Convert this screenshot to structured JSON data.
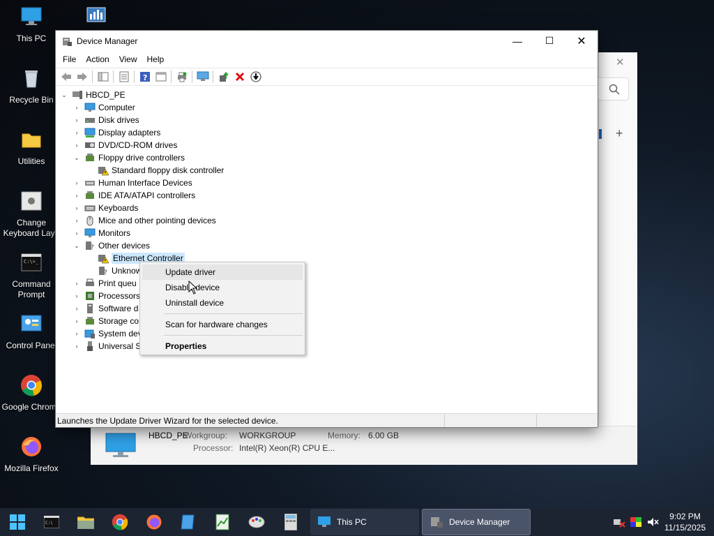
{
  "desktop": {
    "icons": [
      {
        "label": "This PC"
      },
      {
        "label": ""
      },
      {
        "label": "Recycle Bin"
      },
      {
        "label": "Utilities"
      },
      {
        "label": "Change Keyboard Layo"
      },
      {
        "label": "Command Prompt"
      },
      {
        "label": "Control Panel"
      },
      {
        "label": "Google Chrome"
      },
      {
        "label": "Mozilla Firefox"
      }
    ]
  },
  "background_window": {
    "computer_name": "HBCD_PE",
    "workgroup_label": "Workgroup:",
    "workgroup_value": "WORKGROUP",
    "memory_label": "Memory:",
    "memory_value": "6.00 GB",
    "processor_label": "Processor:",
    "processor_value": "Intel(R) Xeon(R) CPU E..."
  },
  "window": {
    "title": "Device Manager",
    "minimize": "—",
    "maximize": "☐",
    "close": "✕"
  },
  "menu": {
    "file": "File",
    "action": "Action",
    "view": "View",
    "help": "Help"
  },
  "tree": {
    "root": "HBCD_PE",
    "nodes": [
      {
        "label": "Computer"
      },
      {
        "label": "Disk drives"
      },
      {
        "label": "Display adapters"
      },
      {
        "label": "DVD/CD-ROM drives"
      },
      {
        "label": "Floppy drive controllers"
      },
      {
        "label": "Standard floppy disk controller"
      },
      {
        "label": "Human Interface Devices"
      },
      {
        "label": "IDE ATA/ATAPI controllers"
      },
      {
        "label": "Keyboards"
      },
      {
        "label": "Mice and other pointing devices"
      },
      {
        "label": "Monitors"
      },
      {
        "label": "Other devices"
      },
      {
        "label": "Ethernet Controller"
      },
      {
        "label": "Unknow"
      },
      {
        "label": "Print queu"
      },
      {
        "label": "Processors"
      },
      {
        "label": "Software d"
      },
      {
        "label": "Storage co"
      },
      {
        "label": "System dev"
      },
      {
        "label": "Universal S"
      }
    ]
  },
  "context_menu": {
    "update": "Update driver",
    "disable": "Disable device",
    "uninstall": "Uninstall device",
    "scan": "Scan for hardware changes",
    "properties": "Properties"
  },
  "status": {
    "text": "Launches the Update Driver Wizard for the selected device."
  },
  "taskbar": {
    "tasks": [
      {
        "label": "This PC"
      },
      {
        "label": "Device Manager"
      }
    ],
    "time": "9:02 PM",
    "date": "11/15/2025"
  }
}
